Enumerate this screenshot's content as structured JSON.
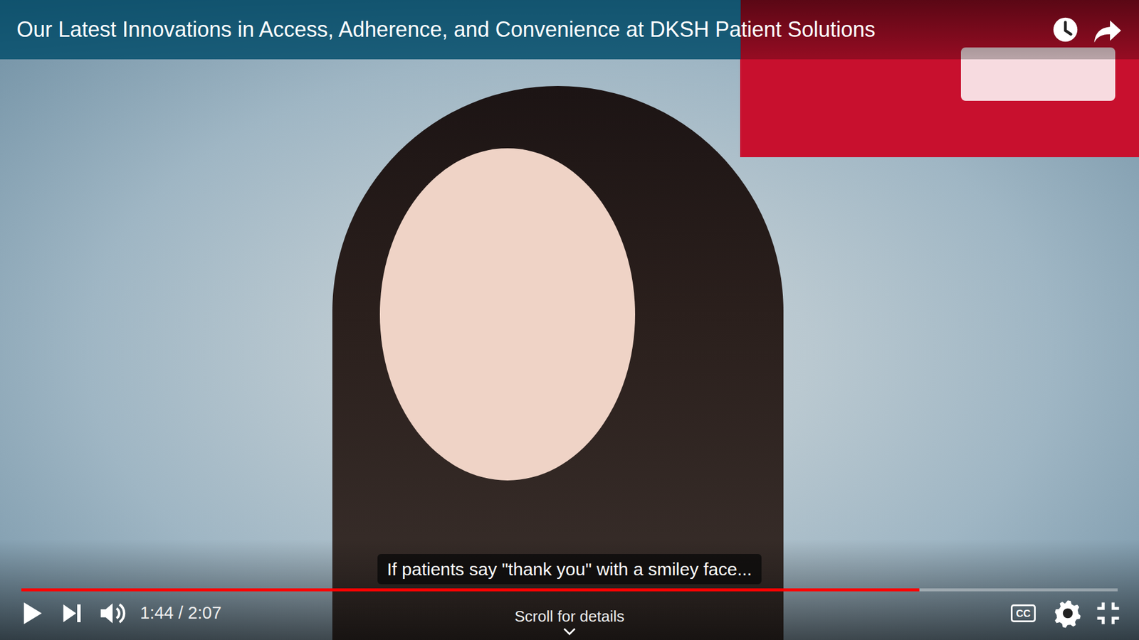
{
  "video": {
    "title": "Our Latest Innovations in Access, Adherence, and Convenience at DKSH Patient Solutions",
    "caption": "If patients say \"thank you\" with a smiley face...",
    "playing": false,
    "progress": 0.819
  },
  "player": {
    "time": "1:44 / 2:07",
    "scroll_hint": "Scroll for details",
    "cc_label": "CC",
    "captions_on": true
  }
}
